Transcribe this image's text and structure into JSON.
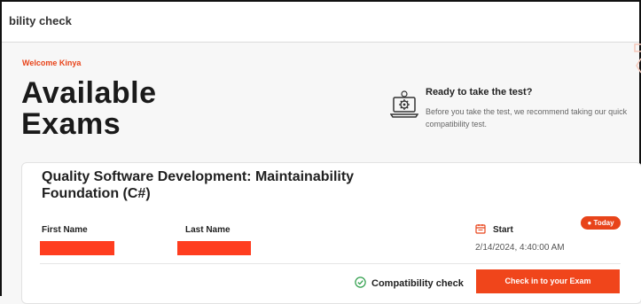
{
  "topbar": {
    "title": "bility check"
  },
  "welcome": "Welcome Kinya",
  "heading": {
    "line1": "Available",
    "line2": "Exams"
  },
  "ready": {
    "title": "Ready to take the test?",
    "text": "Before you take the test, we recommend taking our quick compatibility test."
  },
  "exam": {
    "title_line1": "Quality Software Development: Maintainability",
    "title_line2": "Foundation (C#)",
    "badge": "Today",
    "first_name_label": "First Name",
    "last_name_label": "Last Name",
    "start_label": "Start",
    "start_value": "2/14/2024, 4:40:00 AM",
    "compatibility_label": "Compatibility check",
    "checkin_label": "Check in to your Exam"
  },
  "colors": {
    "accent": "#e8441a",
    "redaction": "#ff3d1f",
    "success": "#2e9e4a"
  },
  "icons": [
    "laptop-gear-icon",
    "calendar-icon",
    "check-circle-icon"
  ]
}
